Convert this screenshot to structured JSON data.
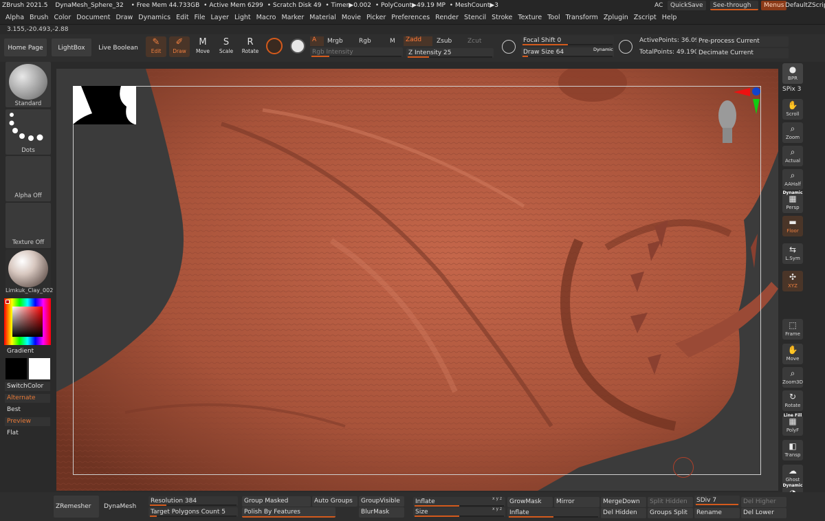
{
  "titlebar": {
    "app": "ZBrush 2021.5",
    "document": "DynaMesh_Sphere_32",
    "free_mem": "• Free Mem 44.733GB",
    "active_mem": "• Active Mem 6299",
    "scratch_disk": "• Scratch Disk 49",
    "timer": "• Timer▶0.002",
    "polycount": "• PolyCount▶49.19 MP",
    "meshcount": "• MeshCount▶3",
    "ac": "AC",
    "quicksave": "QuickSave",
    "see_through": "See-through  0",
    "menus": "Menus",
    "default_zscript": "DefaultZScript"
  },
  "menubar": [
    "Alpha",
    "Brush",
    "Color",
    "Document",
    "Draw",
    "Dynamics",
    "Edit",
    "File",
    "Layer",
    "Light",
    "Macro",
    "Marker",
    "Material",
    "Movie",
    "Picker",
    "Preferences",
    "Render",
    "Stencil",
    "Stroke",
    "Texture",
    "Tool",
    "Transform",
    "Zplugin",
    "Zscript",
    "Help"
  ],
  "coords": "3.155,-20.493,-2.88",
  "toolbar": {
    "home_page": "Home Page",
    "lightbox": "LightBox",
    "live_boolean": "Live Boolean",
    "edit": "Edit",
    "draw": "Draw",
    "move": "Move",
    "scale": "Scale",
    "rotate": "Rotate",
    "a": "A",
    "mrgb": "Mrgb",
    "rgb": "Rgb",
    "m": "M",
    "rgb_intensity": "Rgb Intensity",
    "zadd": "Zadd",
    "zsub": "Zsub",
    "zcut": "Zcut",
    "z_intensity": "Z Intensity 25",
    "z_intensity_value": 25,
    "focal_shift": "Focal Shift 0",
    "draw_size": "Draw Size 64",
    "draw_size_value": 64,
    "dynamic": "Dynamic",
    "active_points": "ActivePoints: 36.091 Mil",
    "total_points": "TotalPoints: 49.190 Mil",
    "preprocess_current": "Pre-process Current",
    "decimate_current": "Decimate Current"
  },
  "left": {
    "brush": "Standard",
    "stroke": "Dots",
    "alpha": "Alpha Off",
    "texture": "Texture Off",
    "material": "Limkuk_Clay_002",
    "gradient": "Gradient",
    "switch_color": "SwitchColor",
    "alternate": "Alternate",
    "best": "Best",
    "preview": "Preview",
    "flat": "Flat"
  },
  "right": {
    "bpr": "BPR",
    "spix": "SPix 3",
    "items": [
      "Scroll",
      "Zoom",
      "Actual",
      "AAHalf",
      "Persp",
      "Floor",
      "L.Sym",
      "XYZ",
      "Frame",
      "Move",
      "Zoom3D",
      "Rotate",
      "PolyF",
      "Transp",
      "Ghost",
      "Solo"
    ],
    "dynamic": "Dynamic",
    "line_fill": "Line Fill"
  },
  "bottom": {
    "zremesher": "ZRemesher",
    "dynamesh": "DynaMesh",
    "resolution": "Resolution 384",
    "resolution_value": 384,
    "target_polygons": "Target Polygons Count 5",
    "group_masked": "Group Masked",
    "auto_groups": "Auto Groups",
    "group_visible": "GroupVisible",
    "polish_by_features": "Polish By Features",
    "blur_mask": "BlurMask",
    "inflate": "Inflate",
    "size": "Size",
    "grow_mask": "GrowMask",
    "mirror": "Mirror",
    "inflate2": "Inflate",
    "merge_down": "MergeDown",
    "del_hidden": "Del Hidden",
    "split_hidden": "Split Hidden",
    "groups_split": "Groups Split",
    "sdiv": "SDiv 7",
    "rename": "Rename",
    "del_higher": "Del Higher",
    "del_lower": "Del Lower",
    "xyz": "x y z"
  }
}
